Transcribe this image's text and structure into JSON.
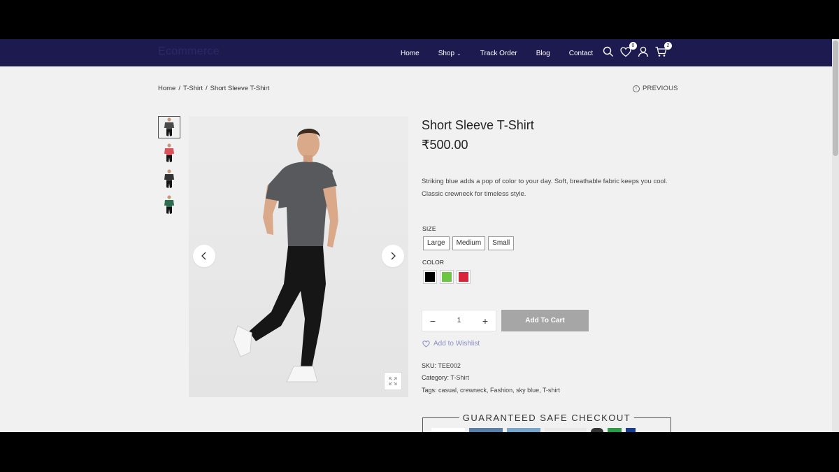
{
  "header": {
    "logo": "Ecommerce",
    "nav": [
      {
        "label": "Home"
      },
      {
        "label": "Shop",
        "has_dropdown": true
      },
      {
        "label": "Track Order"
      },
      {
        "label": "Blog"
      },
      {
        "label": "Contact"
      }
    ],
    "icons": [
      "search-icon",
      "heart-icon",
      "user-icon",
      "cart-icon"
    ],
    "wishlist_count": "0",
    "cart_count": "2"
  },
  "breadcrumb": {
    "home": "Home",
    "category": "T-Shirt",
    "current": "Short Sleeve T-Shirt",
    "sep": "/"
  },
  "previous_label": "PREVIOUS",
  "product": {
    "title": "Short Sleeve T-Shirt",
    "price": "₹500.00",
    "description": "Striking blue adds a pop of color to your day. Soft, breathable fabric keeps you cool. Classic crewneck for timeless style.",
    "size_label": "SIZE",
    "sizes": [
      "Large",
      "Medium",
      "Small"
    ],
    "color_label": "COLOR",
    "colors": [
      "#000000",
      "#6cc644",
      "#d9253a"
    ],
    "quantity": "1",
    "add_to_cart": "Add To Cart",
    "wishlist": "Add to Wishlist",
    "sku_label": "SKU:",
    "sku": "TEE002",
    "category_label": "Category:",
    "category": "T-Shirt",
    "tags_label": "Tags:",
    "tags": "casual, crewneck, Fashion, sky blue, T-shirt"
  },
  "thumbnails": [
    {
      "shirt_color": "#4a4a4a",
      "active": true
    },
    {
      "shirt_color": "#d9535a",
      "active": false
    },
    {
      "shirt_color": "#333333",
      "active": false
    },
    {
      "shirt_color": "#2f6b50",
      "active": false
    }
  ],
  "safe_checkout": "GUARANTEED SAFE CHECKOUT",
  "colors": {
    "header_bg": "#1c1a4f",
    "accent": "#8a8fc8",
    "button_disabled": "#a6a6a6"
  }
}
